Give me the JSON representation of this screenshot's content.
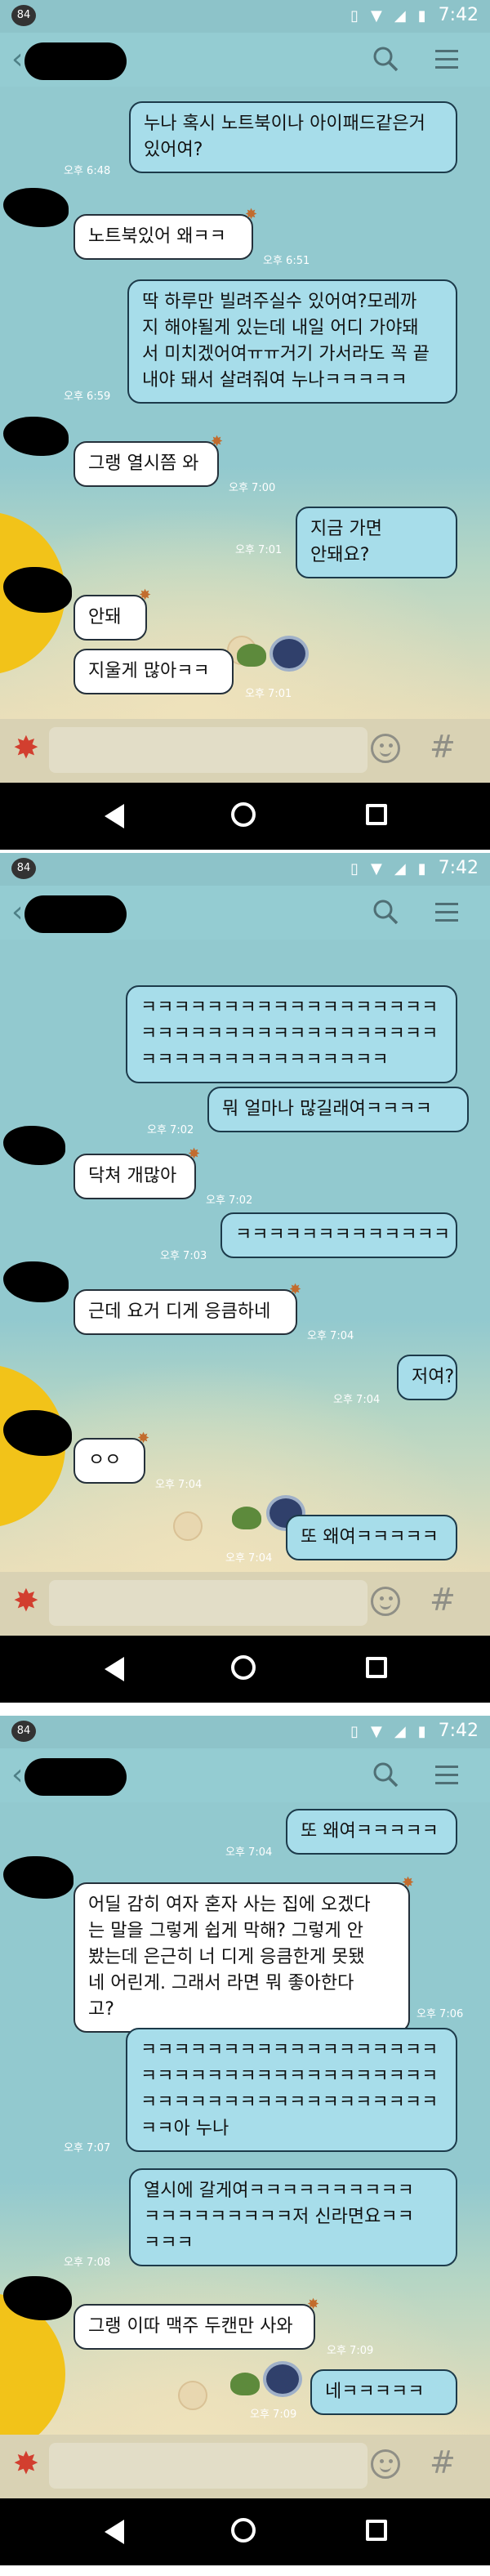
{
  "status_bar": {
    "badge": "84",
    "time": "7:42"
  },
  "icons": {
    "search": "search-icon",
    "menu": "hamburger-menu-icon",
    "emoji": "emoji-icon",
    "hash": "hash-icon",
    "starfish": "starfish-icon"
  },
  "colors": {
    "chat_bg": "#92c9cf",
    "outgoing_bubble": "#a7ddea",
    "incoming_bubble": "#ffffff",
    "nav_bar": "#000000"
  },
  "panels": [
    {
      "messages": [
        {
          "text": "누나 혹시 노트북이나 아이패드같은거\n있어여?",
          "time": "오후 6:48"
        },
        {
          "text": "노트북있어 왜ㅋㅋ",
          "time": "오후 6:51"
        },
        {
          "text": "딱 하루만 빌려주실수 있어여?모레까\n지 해야될게 있는데 내일 어디 가야돼\n서 미치겠어여ㅠㅠ거기 가서라도 꼭 끝\n내야 돼서 살려줘여 누나ㅋㅋㅋㅋㅋ",
          "time": "오후 6:59"
        },
        {
          "text": "그랭 열시쯤 와",
          "time": "오후 7:00"
        },
        {
          "text": "지금 가면 안돼요?",
          "time": "오후 7:01"
        },
        {
          "text": "안돼",
          "time": ""
        },
        {
          "text": "지울게 많아ㅋㅋ",
          "time": "오후 7:01"
        }
      ]
    },
    {
      "messages": [
        {
          "text": "ㅋㅋㅋㅋㅋㅋㅋㅋㅋㅋㅋㅋㅋㅋㅋㅋㅋㅋ\nㅋㅋㅋㅋㅋㅋㅋㅋㅋㅋㅋㅋㅋㅋㅋㅋㅋㅋ\nㅋㅋㅋㅋㅋㅋㅋㅋㅋㅋㅋㅋㅋㅋㅋ",
          "time": ""
        },
        {
          "text": "뭐 얼마나 많길래여ㅋㅋㅋㅋ",
          "time": "오후 7:02"
        },
        {
          "text": "닥쳐 개많아",
          "time": "오후 7:02"
        },
        {
          "text": "ㅋㅋㅋㅋㅋㅋㅋㅋㅋㅋㅋㅋㅋ",
          "time": "오후 7:03"
        },
        {
          "text": "근데 요거 디게 응큼하네",
          "time": "오후 7:04"
        },
        {
          "text": "저여?",
          "time": "오후 7:04"
        },
        {
          "text": "ㅇㅇ",
          "time": "오후 7:04"
        },
        {
          "text": "또 왜여ㅋㅋㅋㅋㅋ",
          "time": "오후 7:04"
        }
      ]
    },
    {
      "messages": [
        {
          "text": "또 왜여ㅋㅋㅋㅋㅋ",
          "time": "오후 7:04"
        },
        {
          "text": "어딜 감히 여자 혼자 사는 집에 오겠다\n는 말을 그렇게 쉽게 막해? 그렇게 안\n봤는데 은근히 너 디게 응큼한게 못됐\n네 어린게. 그래서 라면 뭐 좋아한다\n고?",
          "time": "오후 7:06"
        },
        {
          "text": "ㅋㅋㅋㅋㅋㅋㅋㅋㅋㅋㅋㅋㅋㅋㅋㅋㅋㅋ\nㅋㅋㅋㅋㅋㅋㅋㅋㅋㅋㅋㅋㅋㅋㅋㅋㅋㅋ\nㅋㅋㅋㅋㅋㅋㅋㅋㅋㅋㅋㅋㅋㅋㅋㅋㅋㅋ\nㅋㅋ아 누나",
          "time": "오후 7:07"
        },
        {
          "text": "열시에 갈게여ㅋㅋㅋㅋㅋㅋㅋㅋㅋㅋ\nㅋㅋㅋㅋㅋㅋㅋㅋㅋ저 신라면요ㅋㅋ\nㅋㅋㅋ",
          "time": "오후 7:08"
        },
        {
          "text": "그랭 이따 맥주 두캔만 사와",
          "time": "오후 7:09"
        },
        {
          "text": "네ㅋㅋㅋㅋㅋ",
          "time": "오후 7:09"
        }
      ]
    }
  ]
}
